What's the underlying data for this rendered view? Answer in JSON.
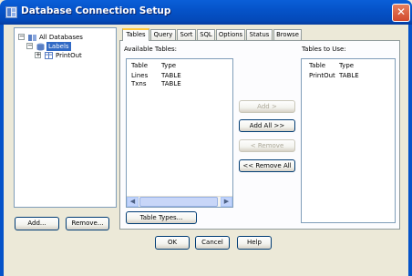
{
  "window": {
    "title": "Database Connection Setup",
    "close_glyph": "✕"
  },
  "tree": {
    "root": {
      "label": "All Databases",
      "expander": "−",
      "icon": "databases-icon"
    },
    "child": {
      "label": "Labels",
      "expander": "−",
      "icon": "database-icon"
    },
    "grandchild": {
      "label": "PrintOut",
      "expander": "+",
      "icon": "table-icon"
    }
  },
  "left_buttons": {
    "add": "Add...",
    "remove": "Remove..."
  },
  "tabs": [
    "Tables",
    "Query",
    "Sort",
    "SQL",
    "Options",
    "Status",
    "Browse"
  ],
  "tables_tab": {
    "available_label": "Available Tables:",
    "to_use_label": "Tables to Use:",
    "columns": [
      "Table",
      "Type"
    ],
    "available": [
      {
        "table": "Lines",
        "type": "TABLE"
      },
      {
        "table": "Txns",
        "type": "TABLE"
      }
    ],
    "to_use": [
      {
        "table": "PrintOut",
        "type": "TABLE"
      }
    ],
    "buttons": {
      "add": "Add >",
      "add_all": "Add All >>",
      "remove": "< Remove",
      "remove_all": "<< Remove All"
    },
    "table_types": "Table Types..."
  },
  "dialog_buttons": {
    "ok": "OK",
    "cancel": "Cancel",
    "help": "Help"
  }
}
